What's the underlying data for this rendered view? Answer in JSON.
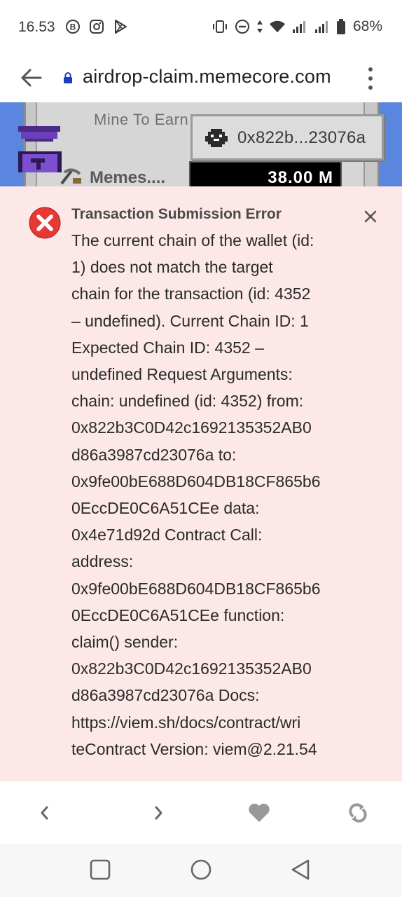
{
  "status_bar": {
    "time": "16.53",
    "battery": "68%",
    "left_icons": [
      "b-circle-icon",
      "instagram-icon",
      "play-store-icon"
    ],
    "right_icons": [
      "vibrate-icon",
      "dnd-icon",
      "data-arrows-icon",
      "wifi-icon",
      "signal-icon",
      "signal-icon",
      "battery-icon"
    ]
  },
  "url_bar": {
    "url": "airdrop-claim.memecore.com"
  },
  "game": {
    "mine_label": "Mine To Earn",
    "wallet_address": "0x822b...23076a",
    "memes_label": "Memes....",
    "memes_value": "38.00  M"
  },
  "error": {
    "title": "Transaction Submission Error",
    "lines": [
      "The current chain of the wallet (id:",
      "1) does not match the target",
      "chain for the transaction (id: 4352",
      "– undefined). Current Chain ID: 1",
      "Expected Chain ID: 4352 –",
      "undefined Request Arguments:",
      "chain: undefined (id: 4352) from:",
      "0x822b3C0D42c1692135352AB0",
      "d86a3987cd23076a to:",
      "0x9fe00bE688D604DB18CF865b6",
      "0EccDE0C6A51CEe data:",
      "0x4e71d92d Contract Call:",
      "address:",
      "0x9fe00bE688D604DB18CF865b6",
      "0EccDE0C6A51CEe function:",
      "claim() sender:",
      "0x822b3C0D42c1692135352AB0",
      "d86a3987cd23076a Docs:",
      "https://viem.sh/docs/contract/wri",
      "teContract Version: viem@2.21.54"
    ]
  },
  "colors": {
    "error_bg": "#fde8e8",
    "error_icon": "#e53935",
    "game_blue": "#5b86e0"
  }
}
